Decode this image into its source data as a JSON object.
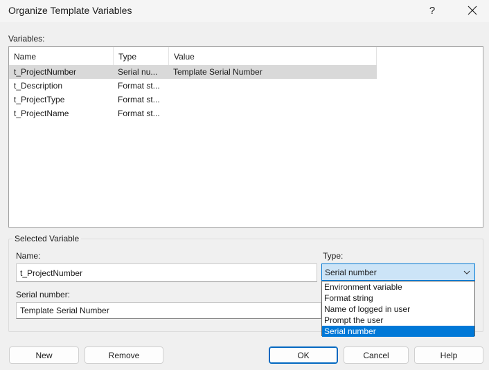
{
  "window": {
    "title": "Organize Template Variables",
    "help_glyph": "?",
    "close_glyph": "close-icon"
  },
  "variables_label": "Variables:",
  "list": {
    "columns": [
      "Name",
      "Type",
      "Value"
    ],
    "rows": [
      {
        "name": "t_ProjectNumber",
        "type": "Serial nu...",
        "value": "Template Serial Number",
        "selected": true
      },
      {
        "name": "t_Description",
        "type": "Format st...",
        "value": ""
      },
      {
        "name": "t_ProjectType",
        "type": "Format st...",
        "value": ""
      },
      {
        "name": "t_ProjectName",
        "type": "Format st...",
        "value": ""
      }
    ]
  },
  "selected_variable": {
    "group_title": "Selected Variable",
    "name_label": "Name:",
    "name_value": "t_ProjectNumber",
    "type_label": "Type:",
    "type_value": "Serial number",
    "serial_label": "Serial number:",
    "serial_value": "Template Serial Number"
  },
  "type_dropdown": {
    "options": [
      "Environment variable",
      "Format string",
      "Name of logged in user",
      "Prompt the user",
      "Serial number"
    ],
    "selected": "Serial number"
  },
  "buttons": {
    "new": "New",
    "remove": "Remove",
    "ok": "OK",
    "cancel": "Cancel",
    "help": "Help"
  },
  "colors": {
    "accent": "#0078d7",
    "window_bg": "#f0f0f0",
    "selection_row": "#d9d9d9"
  }
}
